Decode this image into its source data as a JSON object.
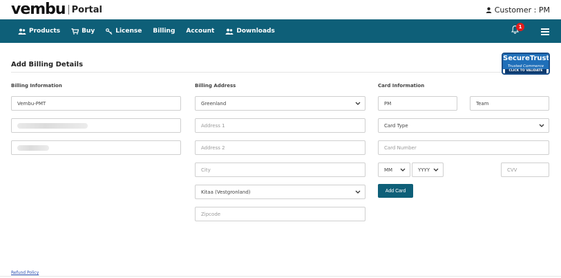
{
  "brand": {
    "logo_text": "vembu",
    "portal_text": "Portal"
  },
  "customer": {
    "label": "Customer : PM"
  },
  "nav": {
    "items": [
      {
        "label": "Products",
        "icon": "users-icon"
      },
      {
        "label": "Buy",
        "icon": "cart-icon"
      },
      {
        "label": "License",
        "icon": "key-icon"
      },
      {
        "label": "Billing"
      },
      {
        "label": "Account"
      },
      {
        "label": "Downloads",
        "icon": "users-icon"
      }
    ],
    "notification_count": "1"
  },
  "page": {
    "title": "Add Billing Details"
  },
  "trust_badge": {
    "line1": "SecureTrust",
    "line2": "Trusted Commerce",
    "line3": "CLICK TO VALIDATE"
  },
  "billing_info": {
    "heading": "Billing Information",
    "name_value": "Vembu-PMT"
  },
  "billing_address": {
    "heading": "Billing Address",
    "country_value": "Greenland",
    "address1_placeholder": "Address 1",
    "address2_placeholder": "Address 2",
    "city_placeholder": "City",
    "region_value": "Kitaa (Vestgronland)",
    "zipcode_placeholder": "Zipcode"
  },
  "card_info": {
    "heading": "Card Information",
    "first_name_value": "PM",
    "last_name_value": "Team",
    "card_type_value": "Card Type",
    "card_number_placeholder": "Card Number",
    "month_value": "MM",
    "year_value": "YYYY",
    "cvv_placeholder": "CVV",
    "add_card_label": "Add Card"
  },
  "footer": {
    "refund_label": "Refund Policy"
  }
}
